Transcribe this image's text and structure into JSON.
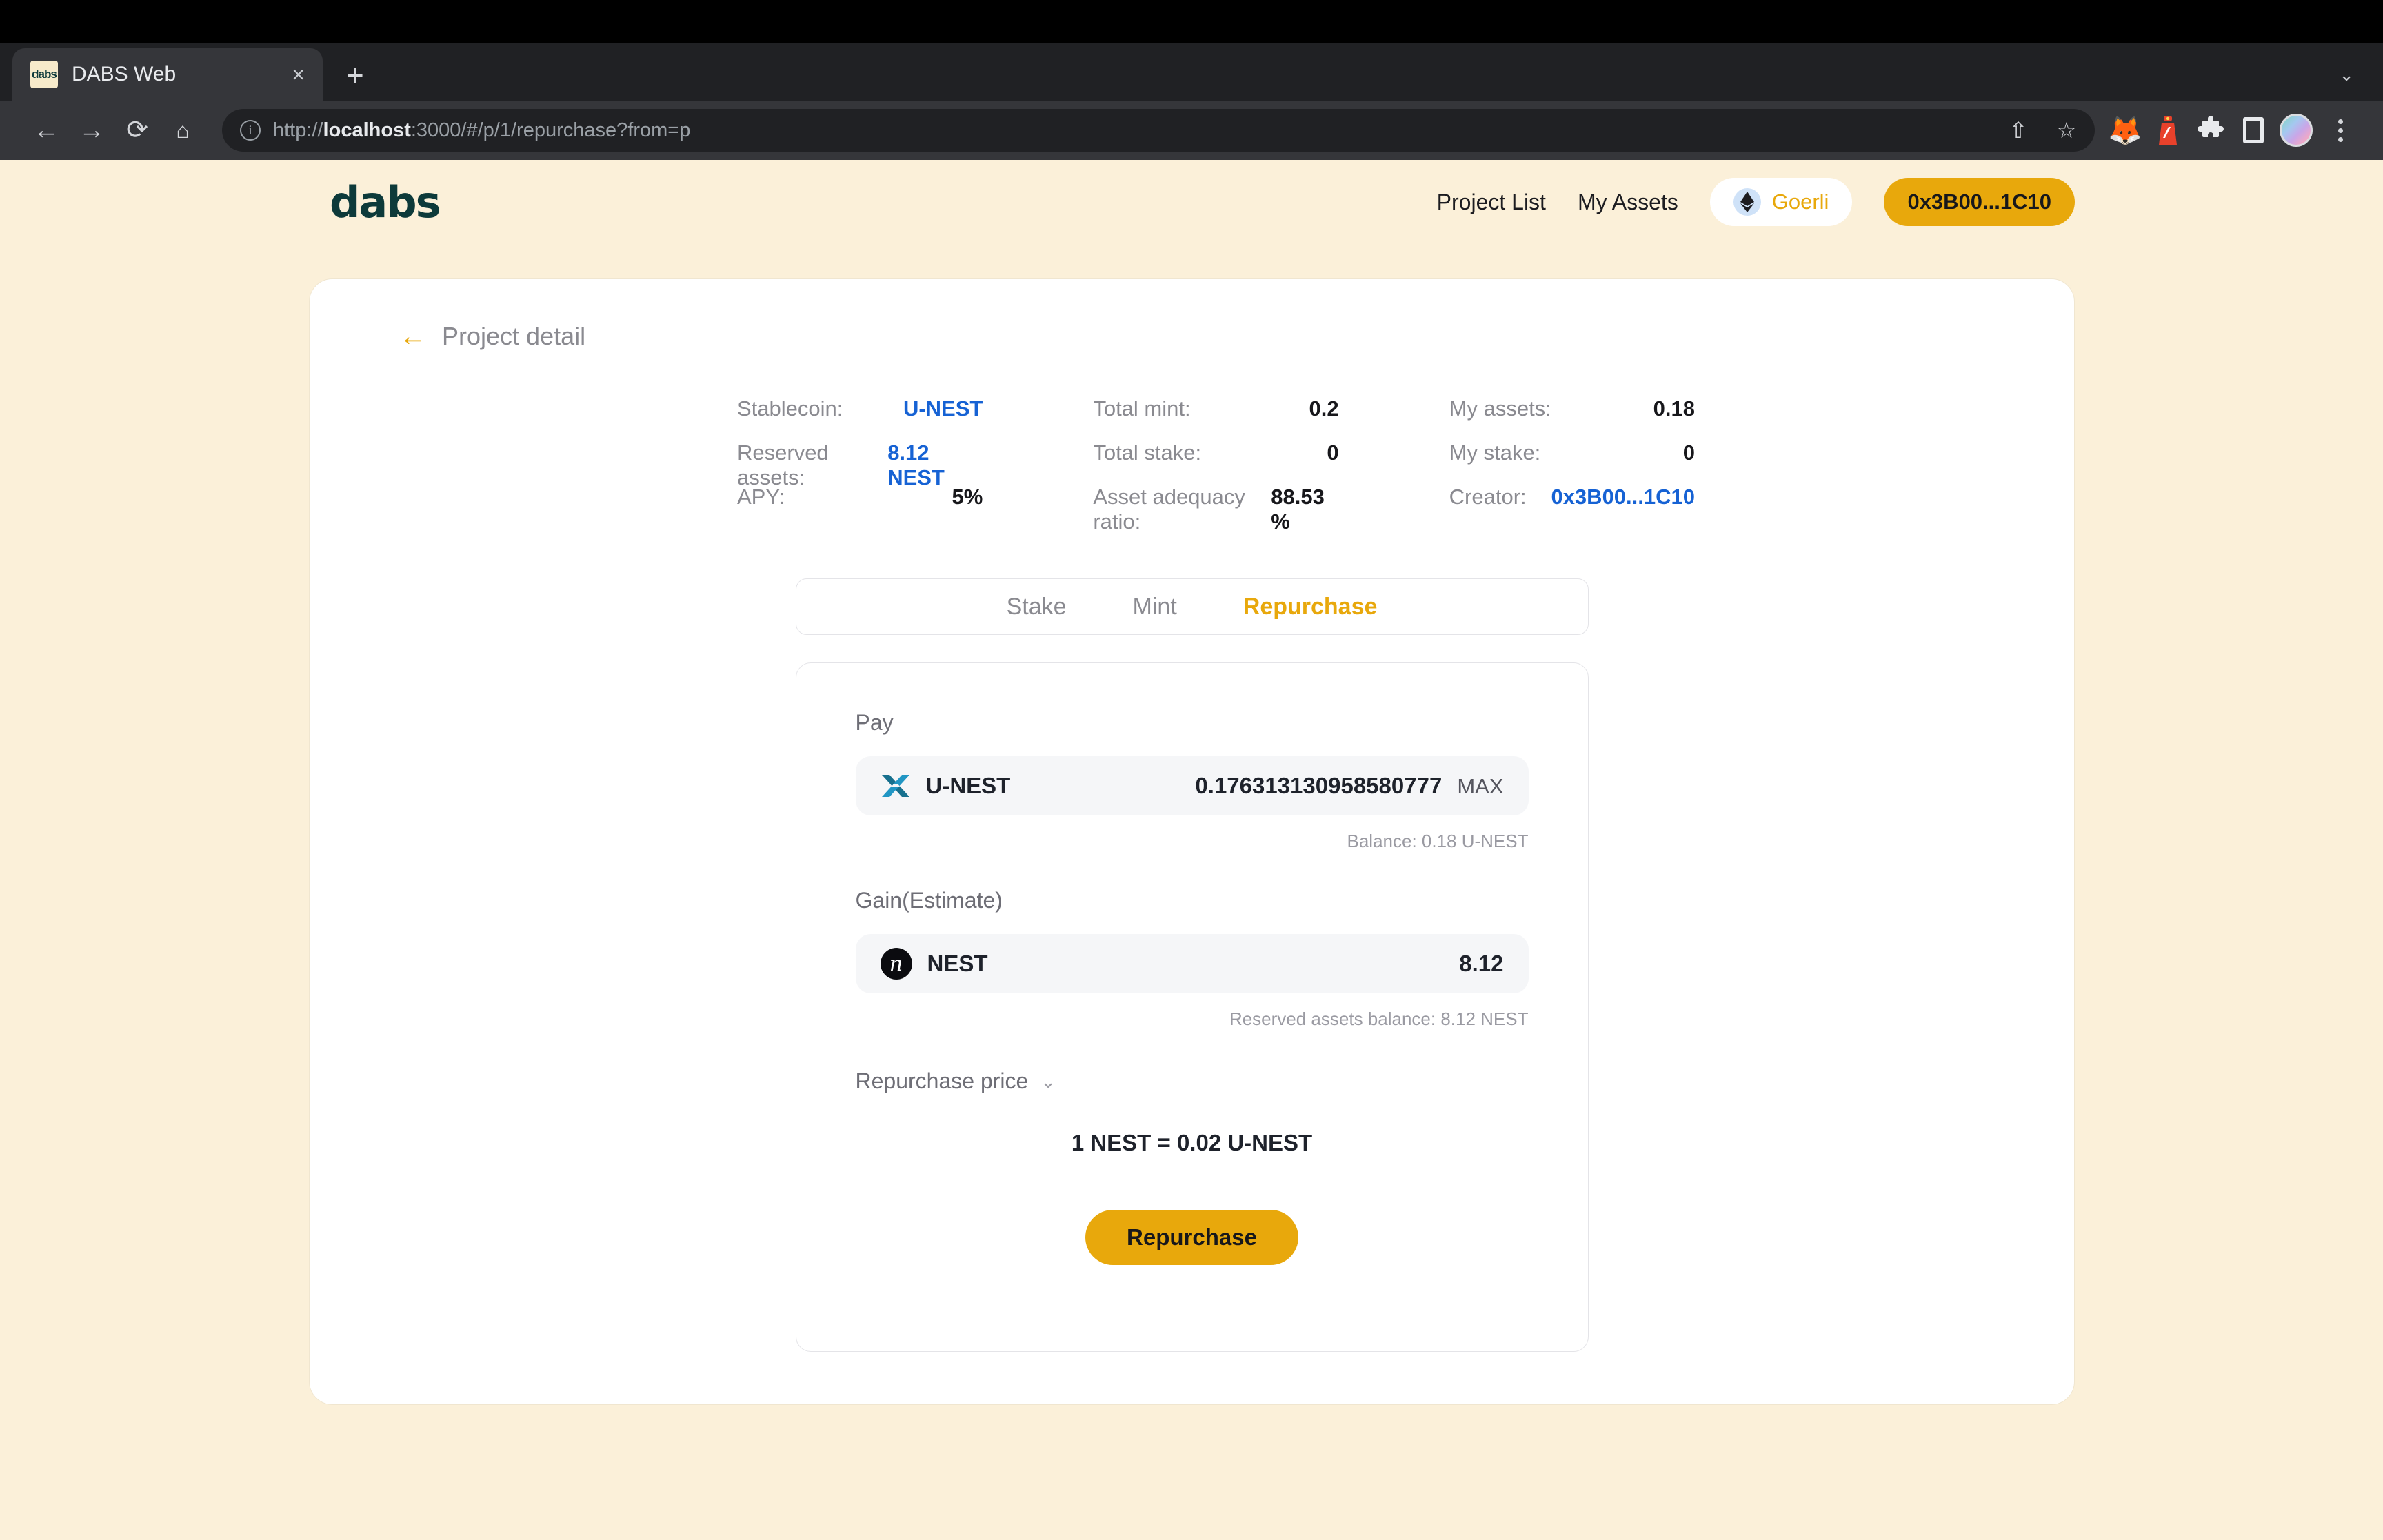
{
  "browser": {
    "tab": {
      "title": "DABS Web",
      "favicon_text": "dabs",
      "close_icon": "×"
    },
    "new_tab_icon": "+",
    "tabstrip_chevron_icon": "⌄",
    "back_icon": "←",
    "forward_icon": "→",
    "reload_icon": "⟳",
    "home_icon": "⌂",
    "url": "http://localhost:3000/#/p/1/repurchase?from=p",
    "url_host": "localhost",
    "url_prefix": "http://",
    "url_suffix": ":3000/#/p/1/repurchase?from=p",
    "share_icon": "⇧",
    "bookmark_icon": "☆",
    "extension_metamask": "🦊",
    "extension_red": "🚨",
    "extensions_icon": "🧩",
    "sidepanel_icon": "sidebar",
    "menu_icon": "⋮"
  },
  "header": {
    "logo": "dabs",
    "nav": [
      {
        "label": "Project List"
      },
      {
        "label": "My Assets"
      }
    ],
    "network": {
      "label": "Goerli",
      "icon": "ethereum-icon"
    },
    "account": {
      "label": "0x3B00...1C10"
    }
  },
  "page": {
    "back_icon": "←",
    "title": "Project detail"
  },
  "stats": {
    "col1": [
      {
        "label": "Stablecoin:",
        "value": "U-NEST",
        "style": "blue"
      },
      {
        "label": "Reserved assets:",
        "value": "8.12 NEST",
        "style": "blue"
      },
      {
        "label": "APY:",
        "value": "5%",
        "style": "dark"
      }
    ],
    "col2": [
      {
        "label": "Total mint:",
        "value": "0.2",
        "style": "dark"
      },
      {
        "label": "Total stake:",
        "value": "0",
        "style": "dark"
      },
      {
        "label": "Asset adequacy ratio:",
        "value": "88.53 %",
        "style": "dark"
      }
    ],
    "col3": [
      {
        "label": "My assets:",
        "value": "0.18",
        "style": "dark"
      },
      {
        "label": "My stake:",
        "value": "0",
        "style": "dark"
      },
      {
        "label": "Creator:",
        "value": "0x3B00...1C10",
        "style": "blue"
      }
    ]
  },
  "tabs": [
    {
      "label": "Stake",
      "active": false
    },
    {
      "label": "Mint",
      "active": false
    },
    {
      "label": "Repurchase",
      "active": true
    }
  ],
  "form": {
    "pay_label": "Pay",
    "pay_token": "U-NEST",
    "pay_token_icon": "u-nest-x-icon",
    "pay_amount": "0.176313130958580777",
    "max_label": "MAX",
    "pay_balance": "Balance: 0.18 U-NEST",
    "gain_label": "Gain(Estimate)",
    "gain_token": "NEST",
    "gain_token_icon": "nest-n-icon",
    "gain_token_glyph": "n",
    "gain_amount": "8.12",
    "gain_balance": "Reserved assets balance: 8.12 NEST",
    "price_label": "Repurchase price",
    "price_chevron": "⌄",
    "rate": "1 NEST = 0.02 U-NEST",
    "submit_label": "Repurchase"
  },
  "colors": {
    "brand_amber": "#E8A80C",
    "page_bg": "#FBF0D9",
    "link_blue": "#1662D4",
    "logo_teal": "#0D3A3A"
  }
}
